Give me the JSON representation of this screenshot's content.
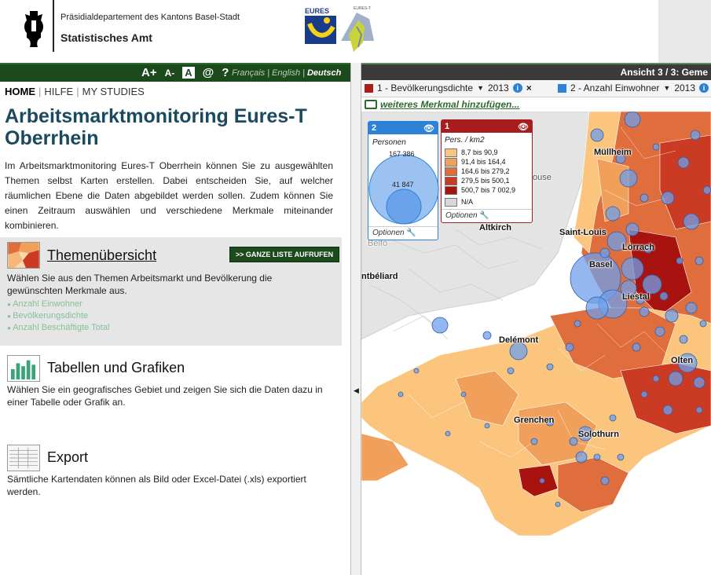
{
  "header": {
    "department": "Präsidialdepartement des Kantons Basel-Stadt",
    "office": "Statistisches Amt",
    "eures_logo_text": "EURES",
    "eurest_logo_text": "EURES-T"
  },
  "toolbar": {
    "font_increase": "A+",
    "font_decrease": "A-",
    "contrast": "A",
    "contact": "@",
    "help": "?",
    "languages": [
      "Français",
      "English",
      "Deutsch"
    ],
    "active_language": "Deutsch"
  },
  "nav": {
    "home": "HOME",
    "help": "HILFE",
    "studies": "MY STUDIES"
  },
  "main": {
    "title": "Arbeitsmarktmonitoring Eures-T Oberrhein",
    "intro": "Im Arbeitsmarktmonitoring Eures-T Oberrhein können Sie zu ausgewählten Themen selbst Karten erstellen. Dabei entscheiden Sie, auf welcher räumlichen Ebene die Daten abgebildet werden sollen. Zudem können Sie einen Zeitraum auswählen und verschiedene Merkmale miteinander kombinieren."
  },
  "sections": {
    "themes": {
      "title": "Themenübersicht",
      "button": ">> GANZE LISTE AUFRUFEN",
      "desc": "Wählen Sie aus den Themen Arbeitsmarkt und Bevölkerung die gewünschten Merkmale aus.",
      "items": [
        "Anzahl Einwohner",
        "Bevölkerungsdichte",
        "Anzahl Beschäftigte Total"
      ]
    },
    "tables": {
      "title": "Tabellen und Grafiken",
      "desc": "Wählen Sie ein geografisches Gebiet und zeigen Sie sich die Daten dazu in einer Tabelle oder Grafik an."
    },
    "export": {
      "title": "Export",
      "desc": "Sämtliche Kartendaten können als Bild oder Excel-Datei (.xls) exportiert werden."
    }
  },
  "map": {
    "view_label": "Ansicht 3 / 3: Geme",
    "add_feature": "weiteres Merkmal hinzufügen...",
    "layer1": {
      "label": "1 - Bevölkerungsdichte",
      "year": "2013",
      "color": "#a81d1d"
    },
    "layer2": {
      "label": "2 - Anzahl Einwohner",
      "year": "2013",
      "color": "#2e82d6"
    },
    "cities": [
      {
        "name": "Müllheim"
      },
      {
        "name": "Saint-Louis"
      },
      {
        "name": "Lörrach"
      },
      {
        "name": "Basel"
      },
      {
        "name": "Altkirch"
      },
      {
        "name": "ntbéliard"
      },
      {
        "name": "Liestal"
      },
      {
        "name": "Delémont"
      },
      {
        "name": "Olten"
      },
      {
        "name": "Grenchen"
      },
      {
        "name": "Solothurn"
      },
      {
        "name": "Belfo"
      },
      {
        "name": "ouse"
      }
    ],
    "legend_circles": {
      "number": "2",
      "unit": "Personen",
      "max_value": "167 386",
      "mid_value": "41 847",
      "options": "Optionen"
    },
    "legend_density": {
      "number": "1",
      "unit": "Pers. / km2",
      "classes": [
        {
          "label": "8,7 bis 90,9",
          "color": "#fbc57e"
        },
        {
          "label": "91,4 bis 164,4",
          "color": "#f0a05a"
        },
        {
          "label": "164,6 bis 279,2",
          "color": "#e06d3c"
        },
        {
          "label": "279,5 bis 500,1",
          "color": "#cb3a22"
        },
        {
          "label": "500,7 bis 7 002,9",
          "color": "#a8130f"
        },
        {
          "label": "N/A",
          "color": "#d8d8d8"
        }
      ],
      "options": "Optionen"
    }
  }
}
